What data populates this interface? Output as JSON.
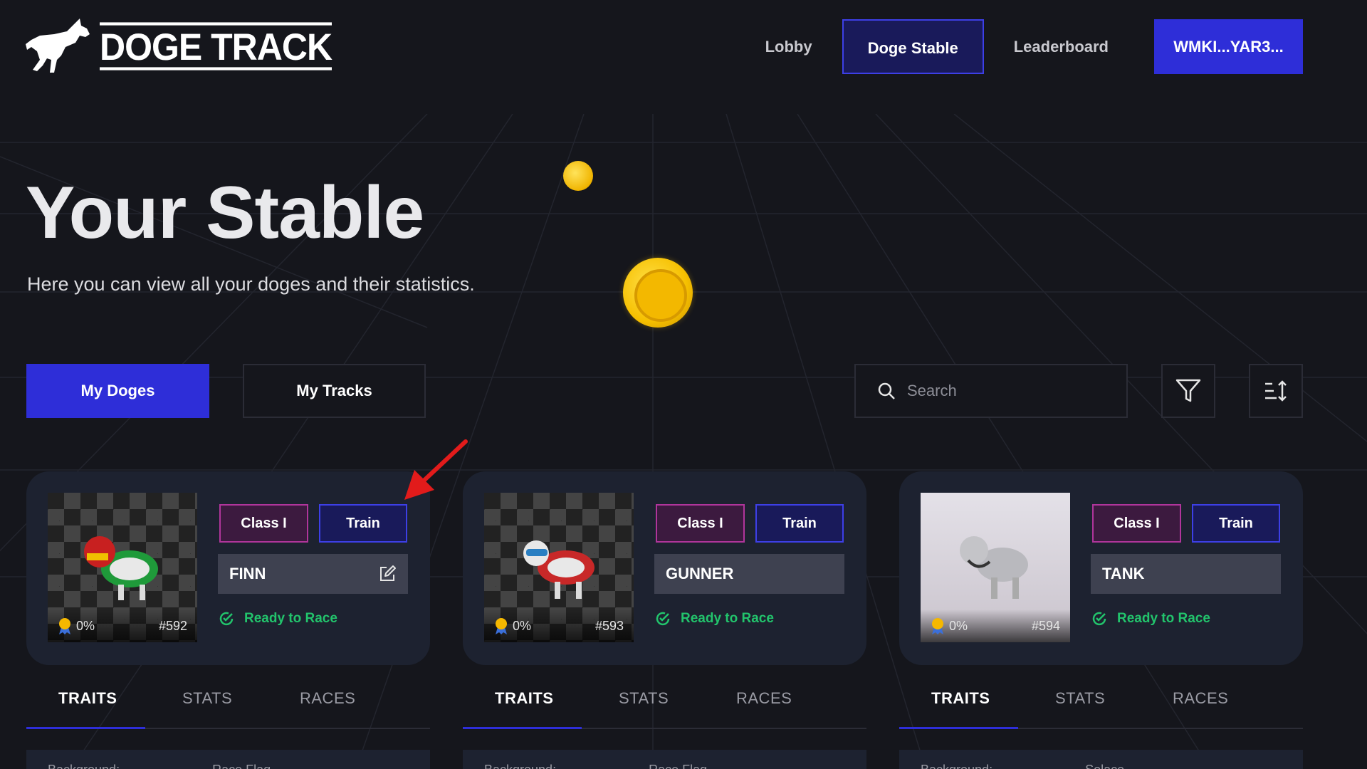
{
  "header": {
    "logo_text": "DOGE TRACK",
    "nav": [
      {
        "label": "Lobby"
      },
      {
        "label": "Doge Stable"
      },
      {
        "label": "Leaderboard"
      }
    ],
    "wallet_label": "WMKI...YAR3..."
  },
  "hero": {
    "title": "Your Stable",
    "subtitle": "Here you can view all your doges and their statistics."
  },
  "toolbar": {
    "my_doges": "My Doges",
    "my_tracks": "My Tracks",
    "search_placeholder": "Search"
  },
  "cards": [
    {
      "name": "FINN",
      "number": "#592",
      "progress": "0%",
      "class_label": "Class I",
      "train_label": "Train",
      "status": "Ready to Race",
      "editable": true,
      "tabs": [
        "TRAITS",
        "STATS",
        "RACES"
      ],
      "trait_label": "Background:",
      "trait_value": "Race Flag"
    },
    {
      "name": "GUNNER",
      "number": "#593",
      "progress": "0%",
      "class_label": "Class I",
      "train_label": "Train",
      "status": "Ready to Race",
      "editable": false,
      "tabs": [
        "TRAITS",
        "STATS",
        "RACES"
      ],
      "trait_label": "Background:",
      "trait_value": "Race Flag"
    },
    {
      "name": "TANK",
      "number": "#594",
      "progress": "0%",
      "class_label": "Class I",
      "train_label": "Train",
      "status": "Ready to Race",
      "editable": false,
      "tabs": [
        "TRAITS",
        "STATS",
        "RACES"
      ],
      "trait_label": "Background:",
      "trait_value": "Solace"
    }
  ],
  "colors": {
    "accent": "#2e2ed8",
    "class_border": "#b0359b",
    "status_green": "#22c46c",
    "annotation_arrow": "#e21b1b"
  }
}
